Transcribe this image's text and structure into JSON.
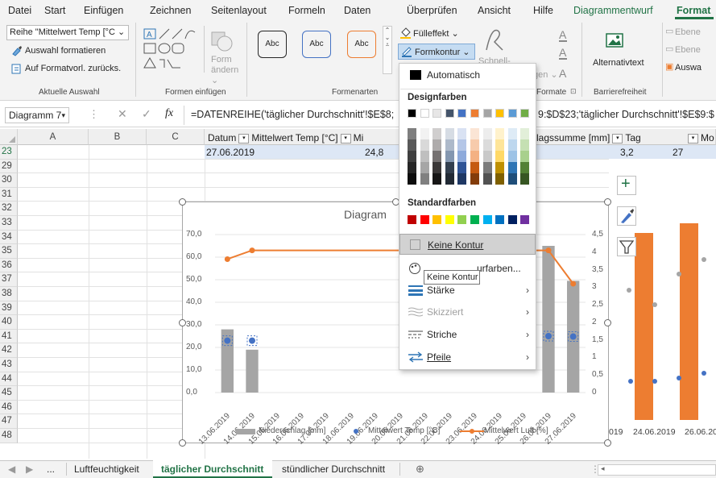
{
  "ribbon_tabs": [
    "Datei",
    "Start",
    "Einfügen",
    "Zeichnen",
    "Seitenlayout",
    "Formeln",
    "Daten",
    "Überprüfen",
    "Ansicht",
    "Hilfe",
    "Diagrammentwurf",
    "Format"
  ],
  "ribbon": {
    "selection_dropdown": "Reihe \"Mittelwert Temp [°C ⌄",
    "format_selection": "Auswahl formatieren",
    "reset_style": "Auf Formatvorl. zurücks.",
    "group_current_selection": "Aktuelle Auswahl",
    "group_insert_shapes": "Formen einfügen",
    "change_shape": "Form ändern ⌄",
    "style_abc": "Abc",
    "group_shape_styles": "Formenarten",
    "fill_effect": "Fülleffekt ⌄",
    "shape_outline": "Formkontur ⌄",
    "quick_styles": "Schnell-",
    "quick_styles_tail": "gen ⌄",
    "wordart_formats": "Formate",
    "alt_text": "Alternativtext",
    "group_accessibility": "Barrierefreiheit",
    "bring_forward": "Ebene",
    "send_backward": "Ebene",
    "selection_pane": "Auswa"
  },
  "formula_bar": {
    "name_box": "Diagramm 7",
    "fx": "fx",
    "formula": "=DATENREIHE('täglicher Durchschnitt'!$E$8;",
    "formula_tail": "9:$D$23;'täglicher Durchschnitt'!$E$9:$"
  },
  "columns": [
    "A",
    "B",
    "C"
  ],
  "rows": [
    "23",
    "29",
    "30",
    "31",
    "32",
    "33",
    "34",
    "35",
    "36",
    "37",
    "38",
    "39",
    "40",
    "41",
    "42",
    "43",
    "44",
    "45",
    "46",
    "47",
    "48"
  ],
  "header_row": {
    "datum": "Datum",
    "mittel_temp": "Mittelwert Temp [°C]",
    "mi": "Mi",
    "niederschlag": "lagssumme [mm]",
    "tag": "Tag",
    "mo": "Mo"
  },
  "row23": {
    "datum": "27.06.2019",
    "temp": "24,8",
    "niederschlag": "3,2",
    "tag": "27"
  },
  "chart_data": {
    "type": "bar",
    "title": "Diagram",
    "categories": [
      "13.06.2019",
      "14.06.2019",
      "15.06.2019",
      "16.06.2019",
      "17.06.2019",
      "18.06.2019",
      "19.06.2019",
      "20.06.2019",
      "21.06.2019",
      "22.06.2019",
      "23.06.2019",
      "24.06.2019",
      "25.06.2019",
      "26.06.2019",
      "27.06.2019"
    ],
    "y_left": {
      "min": 0,
      "max": 70,
      "ticks": [
        "0,0",
        "10,0",
        "20,0",
        "30,0",
        "40,0",
        "50,0",
        "60,0",
        "70,0"
      ]
    },
    "y_right": {
      "min": 0,
      "max": 4.5,
      "ticks": [
        "0",
        "0,5",
        "1",
        "1,5",
        "2",
        "2,5",
        "3",
        "3,5",
        "4",
        "4,5"
      ]
    },
    "series": [
      {
        "name": "Niederschlag [mm]",
        "kind": "bar",
        "axis": "left",
        "color": "#a5a5a5",
        "values": [
          28,
          19,
          0,
          0,
          0,
          0,
          0,
          0,
          0,
          0,
          0,
          0,
          0,
          65,
          49.5
        ]
      },
      {
        "name": "Mittelwert Temp [°C]",
        "kind": "scatter",
        "axis": "left",
        "color": "#4472c4",
        "values": [
          23,
          23,
          null,
          null,
          null,
          null,
          null,
          null,
          null,
          null,
          null,
          null,
          null,
          25,
          24.8
        ]
      },
      {
        "name": "Mittelwert Luft [%]",
        "kind": "line",
        "axis": "right",
        "color": "#ed7d31",
        "values": [
          3.8,
          4.05,
          null,
          null,
          null,
          null,
          null,
          null,
          null,
          null,
          null,
          null,
          null,
          4.05,
          3.1
        ]
      }
    ],
    "legend_position": "bottom"
  },
  "bg_chart": {
    "x_labels": [
      "019",
      "24.06.2019",
      "26.06.20"
    ],
    "bar_color": "#ed7d31",
    "dot_color": "#4472c4",
    "gray_dot_color": "#a5a5a5"
  },
  "menu": {
    "automatic": "Automatisch",
    "theme_colors": "Designfarben",
    "standard_colors": "Standardfarben",
    "no_outline": "Keine Kontur",
    "more_colors": "urfarben...",
    "tooltip": "Keine Kontur",
    "weight": "Stärke",
    "sketched": "Skizziert",
    "dashes": "Striche",
    "arrows": "Pfeile",
    "theme_top": [
      "#000000",
      "#ffffff",
      "#e7e6e6",
      "#44546a",
      "#4472c4",
      "#ed7d31",
      "#a5a5a5",
      "#ffc000",
      "#5b9bd5",
      "#70ad47"
    ],
    "theme_shades": [
      [
        "#7f7f7f",
        "#595959",
        "#3f3f3f",
        "#262626",
        "#0d0d0d"
      ],
      [
        "#f2f2f2",
        "#d9d9d9",
        "#bfbfbf",
        "#a6a6a6",
        "#808080"
      ],
      [
        "#d0cece",
        "#aeabab",
        "#757171",
        "#3b3838",
        "#171616"
      ],
      [
        "#d6dce4",
        "#adb9ca",
        "#8497b0",
        "#333f4f",
        "#222a35"
      ],
      [
        "#d9e2f3",
        "#b4c6e7",
        "#8eaadb",
        "#2f5496",
        "#1f3864"
      ],
      [
        "#fbe5d5",
        "#f7cbac",
        "#f4b183",
        "#c55a11",
        "#833c0b"
      ],
      [
        "#ededed",
        "#dbdbdb",
        "#c9c9c9",
        "#7b7b7b",
        "#525252"
      ],
      [
        "#fff2cc",
        "#fee599",
        "#ffd966",
        "#bf9000",
        "#7f6000"
      ],
      [
        "#deebf6",
        "#bdd7ee",
        "#9dc3e6",
        "#2e75b5",
        "#1f4e79"
      ],
      [
        "#e2efd9",
        "#c5e0b3",
        "#a8d08d",
        "#538135",
        "#375623"
      ]
    ],
    "standard": [
      "#c00000",
      "#ff0000",
      "#ffc000",
      "#ffff00",
      "#92d050",
      "#00b050",
      "#00b0f0",
      "#0070c0",
      "#002060",
      "#7030a0"
    ]
  },
  "sheet_tabs": {
    "ellipsis": "...",
    "tabs": [
      "Luftfeuchtigkeit",
      "täglicher Durchschnitt",
      "stündlicher Durchschnitt"
    ],
    "add": "⊕"
  },
  "accent": "#217346"
}
